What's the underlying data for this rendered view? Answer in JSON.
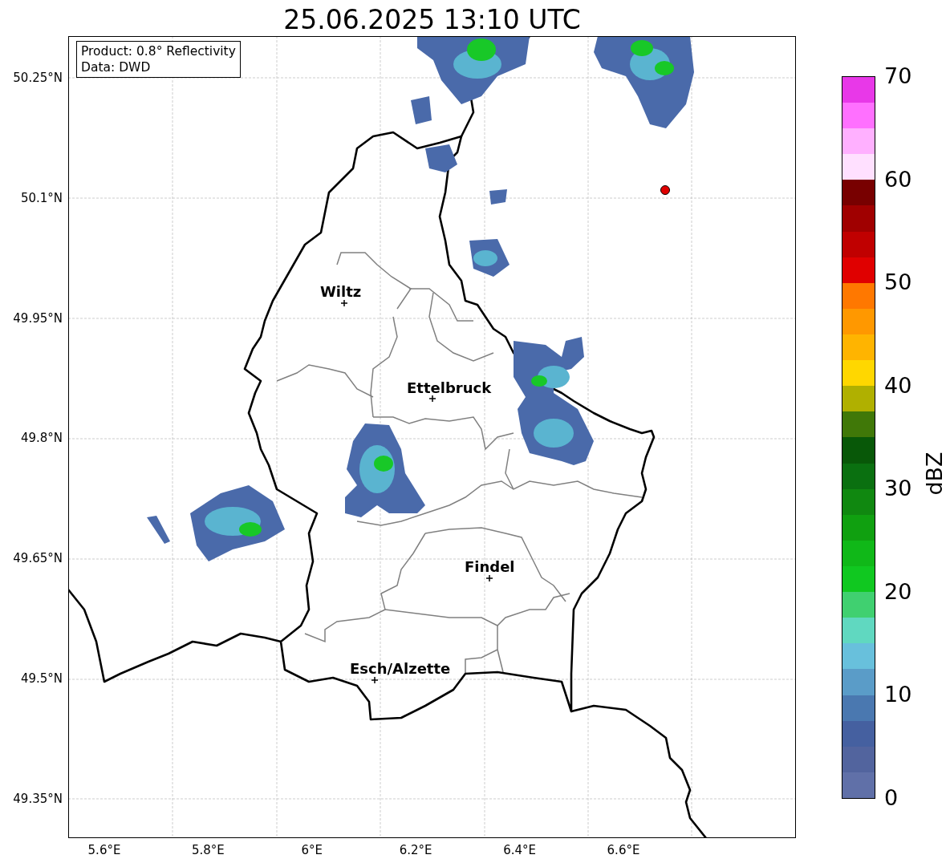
{
  "title": "25.06.2025 13:10 UTC",
  "info_box": [
    "Product: 0.8° Reflectivity",
    "Data: DWD"
  ],
  "map": {
    "lat_ticks": [
      "50.25°N",
      "50.1°N",
      "49.95°N",
      "49.8°N",
      "49.65°N",
      "49.5°N",
      "49.35°N"
    ],
    "lon_ticks": [
      "5.6°E",
      "5.8°E",
      "6°E",
      "6.2°E",
      "6.4°E",
      "6.6°E"
    ],
    "cities": [
      {
        "name": "Wiltz"
      },
      {
        "name": "Ettelbruck"
      },
      {
        "name": "Findel"
      },
      {
        "name": "Esch/Alzette"
      }
    ]
  },
  "colorbar": {
    "label": "dBZ",
    "ticks": [
      "70",
      "60",
      "50",
      "40",
      "30",
      "20",
      "10",
      "0"
    ],
    "segments": [
      {
        "color": "#6070a8"
      },
      {
        "color": "#52649e"
      },
      {
        "color": "#4560a0"
      },
      {
        "color": "#4a78b0"
      },
      {
        "color": "#5a9cc8"
      },
      {
        "color": "#68c0dc"
      },
      {
        "color": "#60d8c0"
      },
      {
        "color": "#40d070"
      },
      {
        "color": "#10c820"
      },
      {
        "color": "#10b818"
      },
      {
        "color": "#10a010"
      },
      {
        "color": "#108810"
      },
      {
        "color": "#0a7010"
      },
      {
        "color": "#085808"
      },
      {
        "color": "#407808"
      },
      {
        "color": "#b0b000"
      },
      {
        "color": "#ffd700"
      },
      {
        "color": "#ffb400"
      },
      {
        "color": "#ff9800"
      },
      {
        "color": "#ff7800"
      },
      {
        "color": "#e00000"
      },
      {
        "color": "#c00000"
      },
      {
        "color": "#a00000"
      },
      {
        "color": "#780000"
      },
      {
        "color": "#ffe0ff"
      },
      {
        "color": "#ffb0ff"
      },
      {
        "color": "#ff70ff"
      },
      {
        "color": "#e838e8"
      }
    ]
  }
}
